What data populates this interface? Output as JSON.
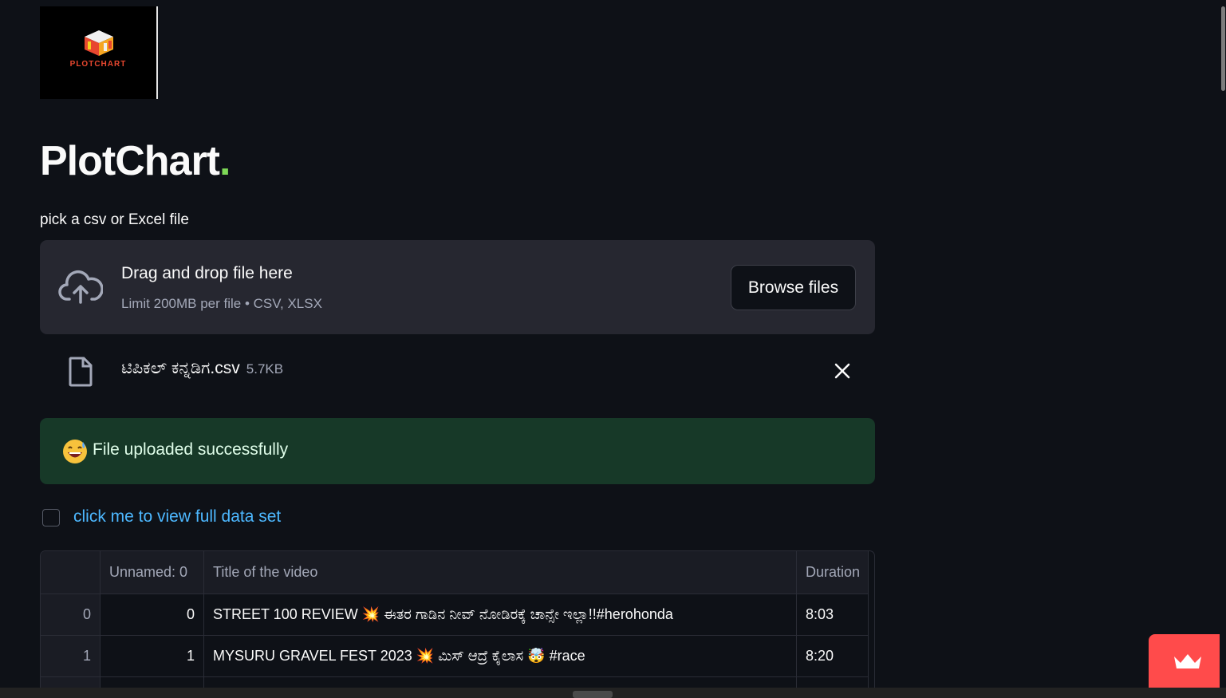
{
  "logo": {
    "text": "PLOTCHART"
  },
  "header": {
    "title": "PlotChart",
    "title_dot": "."
  },
  "uploader": {
    "label": "pick a csv or Excel file",
    "drop_title": "Drag and drop file here",
    "limit_text": "Limit 200MB per file • CSV, XLSX",
    "browse_label": "Browse files"
  },
  "uploaded_file": {
    "name": "ಟಿಪಿಕಲ್ ಕನ್ನಡಿಗ.csv",
    "size": "5.7KB"
  },
  "alert": {
    "message": "File uploaded successfully"
  },
  "checkbox": {
    "label": "click me to view full data set"
  },
  "table": {
    "columns": [
      "",
      "Unnamed: 0",
      "Title of the video",
      "Duration"
    ],
    "rows": [
      {
        "index": "0",
        "unnamed": "0",
        "title": "STREET 100 REVIEW 💥 ಈತರ ಗಾಡಿನ ನೀವ್ ನೋಡಿರಕ್ಕೆ ಚಾನ್ಸೇ ಇಲ್ಲಾ!!#herohonda",
        "duration": "8:03"
      },
      {
        "index": "1",
        "unnamed": "1",
        "title": "MYSURU GRAVEL FEST 2023 💥 ಮಿಸ್ ಆದ್ರೆ ಕೈಲಾಸ 🤯 #race",
        "duration": "8:20"
      }
    ]
  },
  "colors": {
    "background": "#0e1117",
    "dropzone": "#262730",
    "success_bg": "#173928",
    "link": "#4db8ff",
    "accent": "#ff4b4b"
  }
}
